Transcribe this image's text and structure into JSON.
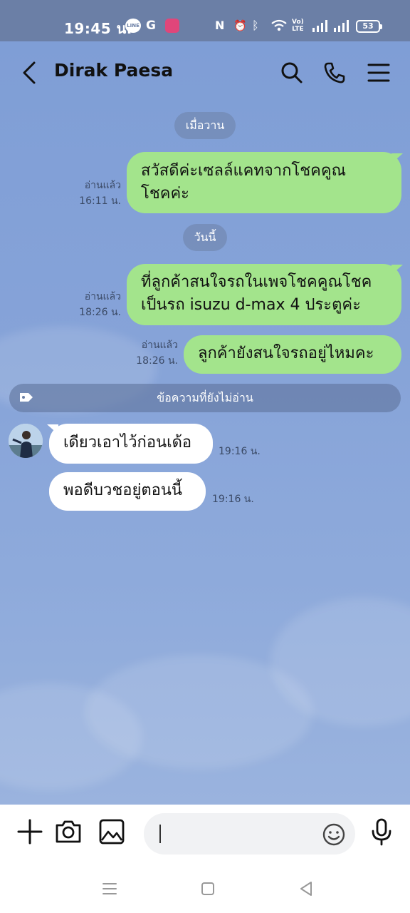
{
  "status_bar": {
    "time": "19:45 น.",
    "battery": "53"
  },
  "chat": {
    "contact_name": "Dirak Paesa"
  },
  "messages": {
    "date_yesterday": "เมื่อวาน",
    "date_today": "วันนี้",
    "m1": {
      "line1": "สวัสดีค่ะเซลล์แคทจากโชคคูณ",
      "line2": "โชคค่ะ",
      "read": "อ่านแล้ว",
      "time": "16:11 น."
    },
    "m2": {
      "line1": "ที่ลูกค้าสนใจรถในเพจโชคคูณโชค",
      "line2": "เป็นรถ isuzu d-max 4 ประตูค่ะ",
      "read": "อ่านแล้ว",
      "time": "18:26 น."
    },
    "m3": {
      "text": "ลูกค้ายังสนใจรถอยู่ไหมคะ",
      "read": "อ่านแล้ว",
      "time": "18:26 น."
    },
    "unread_label": "ข้อความที่ยังไม่อ่าน",
    "m4": {
      "text": "เดียวเอาไว้ก่อนเด้อ",
      "time": "19:16 น."
    },
    "m5": {
      "text": "พอดีบวชอยู่ตอนนี้",
      "time": "19:16 น."
    }
  },
  "icons": {
    "back": "chevron-left",
    "search": "search",
    "call": "phone",
    "menu": "hamburger",
    "add": "plus",
    "camera": "camera",
    "image": "image",
    "emoji": "smiley",
    "mic": "microphone"
  },
  "colors": {
    "outgoing_bubble": "#a3e48c",
    "incoming_bubble": "#ffffff",
    "chat_bg": "#86a3d8",
    "status_bar": "#6b7fa6"
  }
}
